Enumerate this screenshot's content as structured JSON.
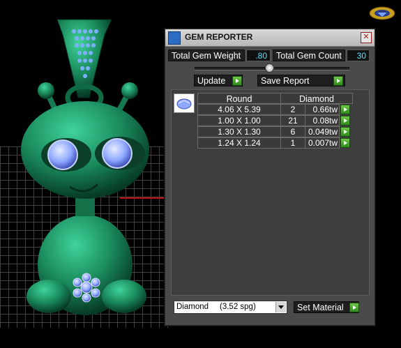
{
  "panel": {
    "title": "GEM REPORTER",
    "close_glyph": "✕",
    "total_weight_label": "Total Gem Weight",
    "total_weight_value": ".80",
    "total_count_label": "Total Gem Count",
    "total_count_value": "30",
    "update_label": "Update",
    "save_report_label": "Save Report",
    "table": {
      "header_shape": "Round",
      "header_material": "Diamond",
      "rows": [
        {
          "size": "4.06 X 5.39",
          "count": "2",
          "weight": "0.66tw"
        },
        {
          "size": "1.00 X 1.00",
          "count": "21",
          "weight": "0.08tw"
        },
        {
          "size": "1.30 X 1.30",
          "count": "6",
          "weight": "0.049tw"
        },
        {
          "size": "1.24 X 1.24",
          "count": "1",
          "weight": "0.007tw"
        }
      ]
    },
    "material_select": "Diamond     (3.52 spg)",
    "set_material_label": "Set Material"
  },
  "colors": {
    "model_green": "#1f8a5e",
    "gem_blue": "#8fa8ff",
    "value_cyan": "#5ee0ff",
    "arrow_green": "#3fa428"
  },
  "icons": [
    "gem-reporter-icon",
    "close-icon",
    "arrow-right-icon",
    "gem-thumbnail-icon",
    "chevron-down-icon",
    "app-logo-icon"
  ]
}
